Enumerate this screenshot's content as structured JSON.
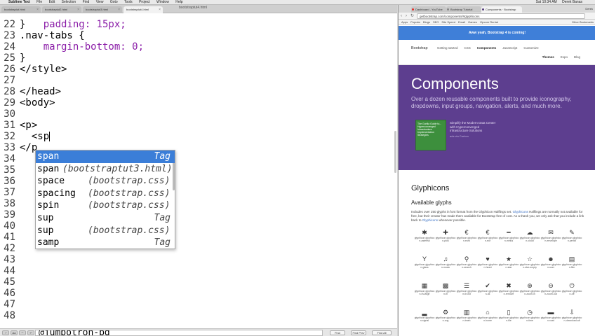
{
  "menubar": {
    "apple": "",
    "app": "Sublime Text",
    "menus": [
      "File",
      "Edit",
      "Selection",
      "Find",
      "View",
      "Goto",
      "Tools",
      "Project",
      "Window",
      "Help"
    ],
    "clock": "Sat 10:34 AM",
    "user": "Derek Banas"
  },
  "editor": {
    "window_title": "bootstraptut4.html",
    "tabs": [
      "bootstraptut.html",
      "bootstraptut2.html",
      "bootstraptut3.html",
      "bootstraptut4.html"
    ],
    "lines": [
      {
        "n": "22",
        "t": "}"
      },
      {
        "n": "23",
        "t": ".nav-tabs {"
      },
      {
        "n": "24",
        "t": "    margin-bottom: 0;"
      },
      {
        "n": "25",
        "t": "}"
      },
      {
        "n": "26",
        "t": "</style>"
      },
      {
        "n": "27",
        "t": ""
      },
      {
        "n": "28",
        "t": "</head>"
      },
      {
        "n": "29",
        "t": "<body>"
      },
      {
        "n": "30",
        "t": ""
      },
      {
        "n": "31",
        "t": "<p>"
      },
      {
        "n": "32",
        "t": "  <sp"
      },
      {
        "n": "33",
        "t": "</p"
      },
      {
        "n": "34",
        "t": ""
      },
      {
        "n": "35",
        "t": ""
      },
      {
        "n": "36",
        "t": ""
      },
      {
        "n": "37",
        "t": ""
      },
      {
        "n": "38",
        "t": ""
      },
      {
        "n": "39",
        "t": ""
      },
      {
        "n": "40",
        "t": ""
      },
      {
        "n": "41",
        "t": ""
      },
      {
        "n": "42",
        "t": ""
      },
      {
        "n": "43",
        "t": ""
      },
      {
        "n": "44",
        "t": ""
      },
      {
        "n": "45",
        "t": ""
      },
      {
        "n": "46",
        "t": ""
      },
      {
        "n": "47",
        "t": ""
      },
      {
        "n": "48",
        "t": ""
      }
    ],
    "first_line_partial": "    padding: 15px;",
    "autocomplete": [
      {
        "label": "span",
        "source": "",
        "hint": "Tag"
      },
      {
        "label": "span",
        "source": "(bootstraptut3.html)",
        "hint": ""
      },
      {
        "label": "space",
        "source": "(bootstrap.css)",
        "hint": ""
      },
      {
        "label": "spacing",
        "source": "(bootstrap.css)",
        "hint": ""
      },
      {
        "label": "spin",
        "source": "(bootstrap.css)",
        "hint": ""
      },
      {
        "label": "sup",
        "source": "",
        "hint": "Tag"
      },
      {
        "label": "sup",
        "source": "(bootstrap.css)",
        "hint": ""
      },
      {
        "label": "samp",
        "source": "",
        "hint": "Tag"
      }
    ],
    "find": {
      "value": "@jumbotron-bg",
      "find_label": "Find",
      "find_prev_label": "Find Prev",
      "find_all_label": "Find All"
    }
  },
  "browser": {
    "tabs": [
      "Dashboard - YouTube",
      "Bootstrap Tutorial",
      "Components · Bootstrap"
    ],
    "user": "Derek",
    "url": "getbootstrap.com/components/#glyphicons",
    "bookmarks": [
      "Apps",
      "Popular",
      "Blogs",
      "SEO",
      "Site Speed",
      "Email",
      "Games",
      "Vipcom Rental"
    ],
    "other_bookmarks": "Other Bookmarks",
    "alert": "Aww yeah, Bootstrap 4 is coming!",
    "nav": {
      "brand": "Bootstrap",
      "links": [
        "Getting started",
        "CSS",
        "Components",
        "JavaScript",
        "Customize"
      ],
      "active": "Components",
      "sub": [
        "Themes",
        "Expo",
        "Blog"
      ]
    },
    "hero": {
      "title": "Components",
      "lead": "Over a dozen reusable components built to provide iconography, dropdowns, input groups, navigation, alerts, and much more.",
      "ad_image_text": "The Gorilla Guide to... Hyperconverged Infrastructure Implementation Strategies",
      "ad_text": "Simplify the Modern Data Center with Hyperconverged Infrastructure Solutions",
      "ad_by": "ads via Carbon"
    },
    "section": {
      "title": "Glyphicons",
      "subtitle": "Available glyphs",
      "desc_a": "Includes over 250 glyphs in font format from the Glyphicon Halflings set.",
      "desc_link": "Glyphicons",
      "desc_b": "Halflings are normally not available for free, but their creator has made them available for Bootstrap free of cost. As a thank you, we only ask that you include a link back to",
      "desc_link2": "Glyphicons",
      "desc_c": "whenever possible."
    },
    "glyphs": [
      {
        "g": "✱",
        "l": "glyphicon glyphicon-asterisk"
      },
      {
        "g": "✚",
        "l": "glyphicon glyphicon-plus"
      },
      {
        "g": "€",
        "l": "glyphicon glyphicon-euro"
      },
      {
        "g": "€",
        "l": "glyphicon glyphicon-eur"
      },
      {
        "g": "━",
        "l": "glyphicon glyphicon-minus"
      },
      {
        "g": "☁",
        "l": "glyphicon glyphicon-cloud"
      },
      {
        "g": "✉",
        "l": "glyphicon glyphicon-envelope"
      },
      {
        "g": "✎",
        "l": "glyphicon glyphicon-pencil"
      },
      {
        "g": "Y",
        "l": "glyphicon glyphicon-glass"
      },
      {
        "g": "♫",
        "l": "glyphicon glyphicon-music"
      },
      {
        "g": "⚲",
        "l": "glyphicon glyphicon-search"
      },
      {
        "g": "♥",
        "l": "glyphicon glyphicon-heart"
      },
      {
        "g": "★",
        "l": "glyphicon glyphicon-star"
      },
      {
        "g": "☆",
        "l": "glyphicon glyphicon-star-empty"
      },
      {
        "g": "☻",
        "l": "glyphicon glyphicon-user"
      },
      {
        "g": "▤",
        "l": "glyphicon glyphicon-film"
      },
      {
        "g": "▦",
        "l": "glyphicon glyphicon-th-large"
      },
      {
        "g": "▩",
        "l": "glyphicon glyphicon-th"
      },
      {
        "g": "☰",
        "l": "glyphicon glyphicon-th-list"
      },
      {
        "g": "✔",
        "l": "glyphicon glyphicon-ok"
      },
      {
        "g": "✖",
        "l": "glyphicon glyphicon-remove"
      },
      {
        "g": "⊕",
        "l": "glyphicon glyphicon-zoom-in"
      },
      {
        "g": "⊖",
        "l": "glyphicon glyphicon-zoom-out"
      },
      {
        "g": "⏻",
        "l": "glyphicon glyphicon-off"
      },
      {
        "g": "▂",
        "l": "glyphicon glyphicon-signal"
      },
      {
        "g": "⚙",
        "l": "glyphicon glyphicon-cog"
      },
      {
        "g": "▥",
        "l": "glyphicon glyphicon-trash"
      },
      {
        "g": "⌂",
        "l": "glyphicon glyphicon-home"
      },
      {
        "g": "▯",
        "l": "glyphicon glyphicon-file"
      },
      {
        "g": "◷",
        "l": "glyphicon glyphicon-time"
      },
      {
        "g": "▬",
        "l": "glyphicon glyphicon-road"
      },
      {
        "g": "⇩",
        "l": "glyphicon glyphicon-download-alt"
      }
    ]
  }
}
